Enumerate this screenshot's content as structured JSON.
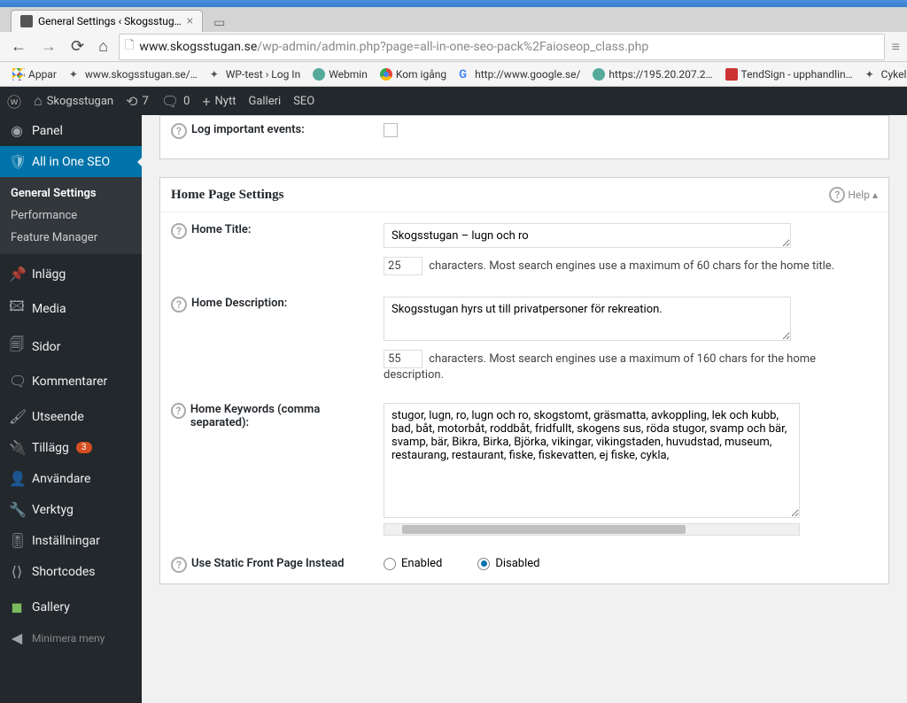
{
  "browser": {
    "tab_title": "General Settings ‹ Skogsstug…",
    "url_domain": "www.skogsstugan.se",
    "url_path": "/wp-admin/admin.php?page=all-in-one-seo-pack%2Faioseop_class.php"
  },
  "bookmarks": {
    "apps": "Appar",
    "items": [
      "www.skogsstugan.se/…",
      "WP-test › Log In",
      "Webmin",
      "Kom igång",
      "http://www.google.se/",
      "https://195.20.207.2…",
      "TendSign - upphandlin…",
      "Cykelbanan nu!"
    ]
  },
  "adminbar": {
    "site": "Skogsstugan",
    "updates": "7",
    "comments": "0",
    "new": "Nytt",
    "gallery": "Galleri",
    "seo": "SEO"
  },
  "sidebar": {
    "panel": "Panel",
    "aio": "All in One SEO",
    "aio_sub": {
      "general": "General Settings",
      "performance": "Performance",
      "feature": "Feature Manager"
    },
    "inlagg": "Inlägg",
    "media": "Media",
    "sidor": "Sidor",
    "kommentarer": "Kommentarer",
    "utseende": "Utseende",
    "tillagg": "Tillägg",
    "tillagg_count": "3",
    "anvandare": "Användare",
    "verktyg": "Verktyg",
    "installningar": "Inställningar",
    "shortcodes": "Shortcodes",
    "gallery": "Gallery",
    "collapse": "Minimera meny"
  },
  "content": {
    "log_events_label": "Log important events:",
    "section_title": "Home Page Settings",
    "help_label": "Help",
    "home_title": {
      "label": "Home Title:",
      "value": "Skogsstugan – lugn och ro",
      "count": "25",
      "hint": "characters. Most search engines use a maximum of 60 chars for the home title."
    },
    "home_desc": {
      "label": "Home Description:",
      "value": "Skogsstugan hyrs ut till privatpersoner för rekreation.",
      "count": "55",
      "hint": "characters. Most search engines use a maximum of 160 chars for the home description."
    },
    "home_keywords": {
      "label": "Home Keywords (comma separated):",
      "value": "stugor, lugn, ro, lugn och ro, skogstomt, gräsmatta, avkoppling, lek och kubb, bad, båt, motorbåt, roddbåt, fridfullt, skogens sus, röda stugor, svamp och bär, svamp, bär, Bikra, Birka, Björka, vikingar, vikingstaden, huvudstad, museum, restaurang, restaurant, fiske, fiskevatten, ej fiske, cykla,"
    },
    "static_front": {
      "label": "Use Static Front Page Instead",
      "enabled": "Enabled",
      "disabled": "Disabled"
    }
  }
}
